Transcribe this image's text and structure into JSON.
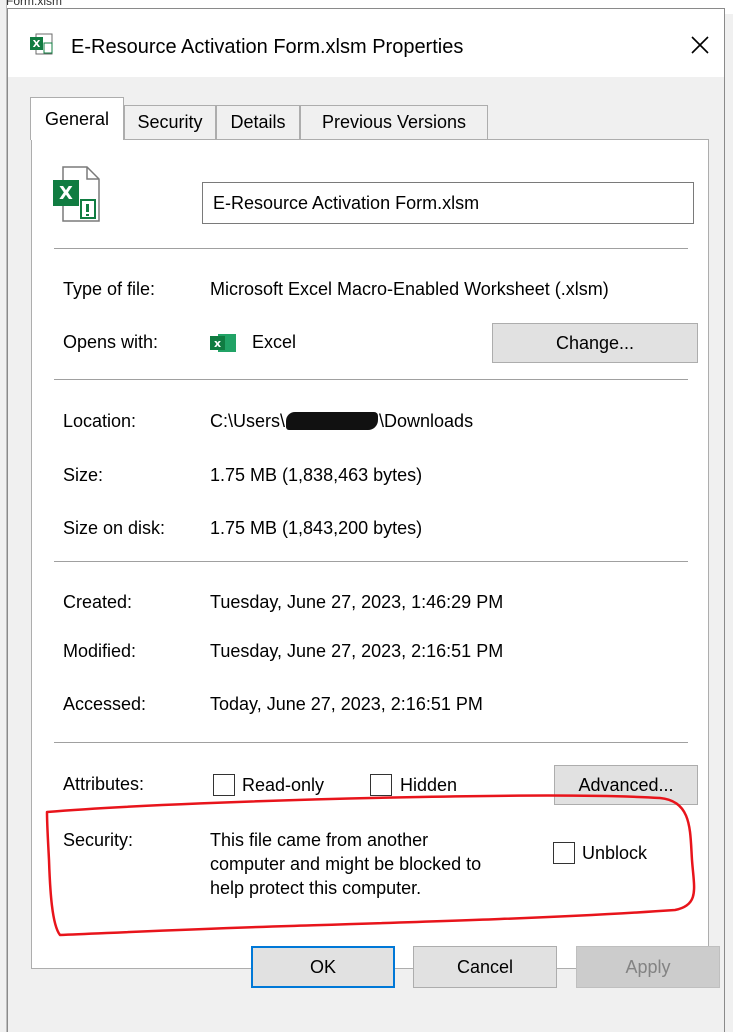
{
  "background": {
    "partial_text": "Form.xlsm"
  },
  "window": {
    "title": "E-Resource Activation Form.xlsm Properties",
    "close_glyph": "✕"
  },
  "tabs": [
    {
      "label": "General"
    },
    {
      "label": "Security"
    },
    {
      "label": "Details"
    },
    {
      "label": "Previous Versions"
    }
  ],
  "file": {
    "name": "E-Resource Activation Form.xlsm",
    "type_label": "Type of file:",
    "type_value": "Microsoft Excel Macro-Enabled Worksheet (.xlsm)",
    "opens_label": "Opens with:",
    "opens_value": "Excel",
    "change_button": "Change...",
    "location_label": "Location:",
    "location_prefix": "C:\\Users\\",
    "location_suffix": "\\Downloads",
    "size_label": "Size:",
    "size_value": "1.75 MB (1,838,463 bytes)",
    "size_disk_label": "Size on disk:",
    "size_disk_value": "1.75 MB (1,843,200 bytes)",
    "created_label": "Created:",
    "created_value": "Tuesday, June 27, 2023, 1:46:29 PM",
    "modified_label": "Modified:",
    "modified_value": "Tuesday, June 27, 2023, 2:16:51 PM",
    "accessed_label": "Accessed:",
    "accessed_value": "Today, June 27, 2023, 2:16:51 PM"
  },
  "attributes": {
    "label": "Attributes:",
    "readonly_label": "Read-only",
    "hidden_label": "Hidden",
    "advanced_button": "Advanced..."
  },
  "security": {
    "label": "Security:",
    "line1": "This file came from another",
    "line2": "computer and might be blocked to",
    "line3": "help protect this computer.",
    "unblock_label": "Unblock"
  },
  "buttons": {
    "ok": "OK",
    "cancel": "Cancel",
    "apply": "Apply"
  },
  "colors": {
    "excel_green": "#107c41",
    "annotation_red": "#e8141b",
    "focus_blue": "#0078d7"
  }
}
